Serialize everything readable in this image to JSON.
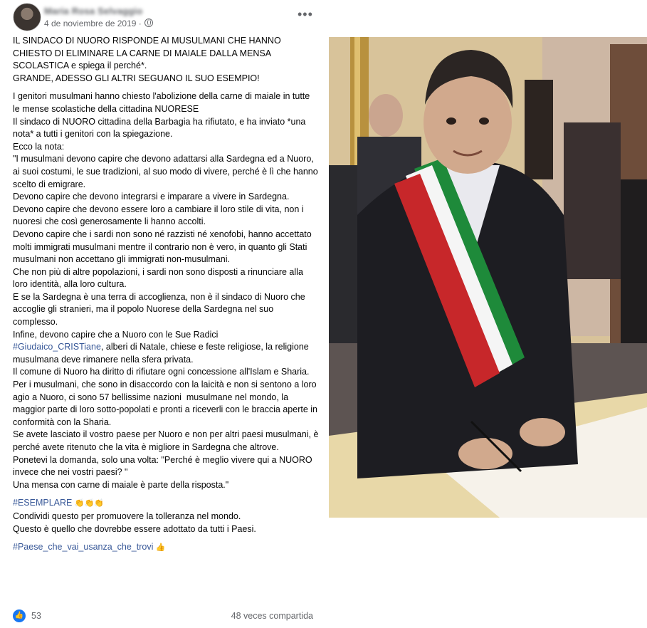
{
  "post": {
    "author": "Maria Rosa Selvaggio",
    "date": "4 de noviembre de 2019 ·",
    "more_menu": "•••",
    "headline": "IL SINDACO DI NUORO RISPONDE AI MUSULMANI CHE HANNO CHIESTO DI ELIMINARE LA CARNE DI MAIALE DALLA MENSA SCOLASTICA e spiega il perché*.\nGRANDE, ADESSO GLI ALTRI SEGUANO IL SUO ESEMPIO!",
    "body_1": "I genitori musulmani hanno chiesto l'abolizione della carne di maiale in tutte le mense scolastiche della cittadina NUORESE\nIl sindaco di NUORO cittadina della Barbagia ha rifiutato, e ha inviato *una nota* a tutti i genitori con la spiegazione.\nEcco la nota:\n\"I musulmani devono capire che devono adattarsi alla Sardegna ed a Nuoro, ai suoi costumi, le sue tradizioni, al suo modo di vivere, perché è lì che hanno scelto di emigrare.\nDevono capire che devono integrarsi e imparare a vivere in Sardegna.\nDevono capire che devono essere loro a cambiare il loro stile di vita, non i nuoresi che così generosamente li hanno accolti.\nDevono capire che i sardi non sono né razzisti né xenofobi, hanno accettato molti immigrati musulmani mentre il contrario non è vero, in quanto gli Stati musulmani non accettano gli immigrati non-musulmani.\nChe non più di altre popolazioni, i sardi non sono disposti a rinunciare alla loro identità, alla loro cultura.\nE se la Sardegna è una terra di accoglienza, non è il sindaco di Nuoro che accoglie gli stranieri, ma il popolo Nuorese della Sardegna nel suo complesso.\nInfine, devono capire che a Nuoro con le Sue Radici",
    "hashtag_giudaico": "#Giudaico_CRISTiane",
    "body_2": ", alberi di Natale, chiese e feste religiose, la religione musulmana deve rimanere nella sfera privata.\nIl comune di Nuoro ha diritto di rifiutare ogni concessione all'Islam e Sharia.\nPer i musulmani, che sono in disaccordo con la laicità e non si sentono a loro agio a Nuoro, ci sono 57 bellissime nazioni  musulmane nel mondo, la maggior parte di loro sotto-popolati e pronti a riceverli con le braccia aperte in conformità con la Sharia.\nSe avete lasciato il vostro paese per Nuoro e non per altri paesi musulmani, è perché avete ritenuto che la vita è migliore in Sardegna che altrove.\nPonetevi la domanda, solo una volta: \"Perché è meglio vivere qui a NUORO invece che nei vostri paesi? \"\nUna mensa con carne di maiale è parte della risposta.\"",
    "hashtag_esemplare": "#ESEMPLARE",
    "clap_emojis": "👏👏👏",
    "closing": "Condividi questo per promuovere la tolleranza nel mondo.\nQuesto è quello che dovrebbe essere adottato da tutti i Paesi.",
    "hashtag_paese": "#Paese_che_vai_usanza_che_trovi",
    "thumb_emoji": "👍"
  },
  "reactions": {
    "like_icon": "👍",
    "count": "53",
    "shares": "48 veces compartida"
  },
  "colors": {
    "hashtag": "#385898",
    "secondary_text": "#65676b",
    "like_blue": "#1877f2"
  }
}
